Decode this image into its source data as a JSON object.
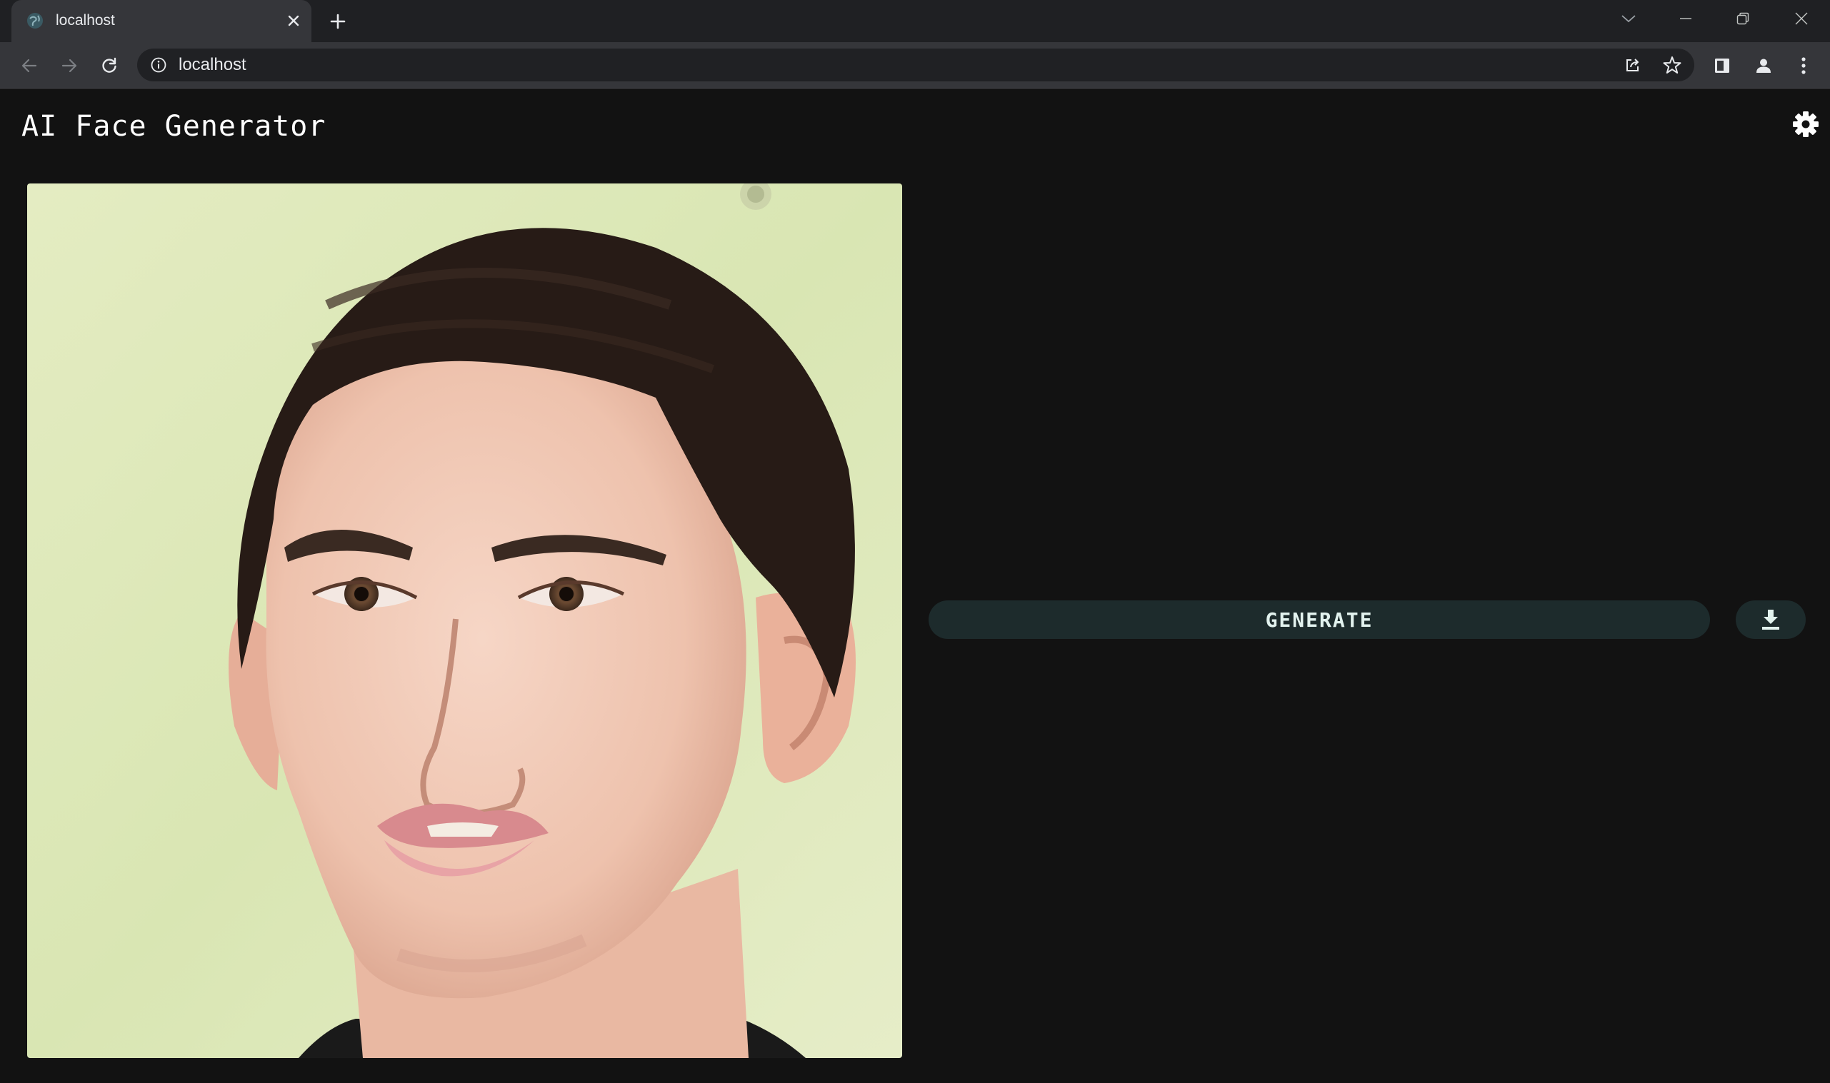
{
  "browser": {
    "tab": {
      "title": "localhost",
      "favicon": "globe-favicon-icon"
    },
    "address_bar": {
      "url": "localhost"
    },
    "icons": {
      "close_tab": "close-icon",
      "new_tab": "plus-icon",
      "back": "back-arrow-icon",
      "forward": "forward-arrow-icon",
      "reload": "reload-icon",
      "site_info": "info-icon",
      "share": "share-icon",
      "bookmark": "star-icon",
      "side_panel": "side-panel-icon",
      "profile": "profile-icon",
      "menu": "more-vertical-icon",
      "tab_search": "chevron-down-icon",
      "minimize": "minimize-icon",
      "restore": "restore-icon",
      "close_window": "close-icon"
    },
    "colors": {
      "tabstrip": "#1f2023",
      "toolbar": "#35363a",
      "omnibox": "#202124"
    }
  },
  "app": {
    "title": "AI Face Generator",
    "settings_icon": "gear-icon",
    "image": {
      "alt": "AI generated face"
    },
    "generate_label": "GENERATE",
    "download_icon": "download-icon",
    "colors": {
      "background": "#121212",
      "button_bg": "#1d2b2c",
      "button_text": "#e2f2ee"
    }
  }
}
